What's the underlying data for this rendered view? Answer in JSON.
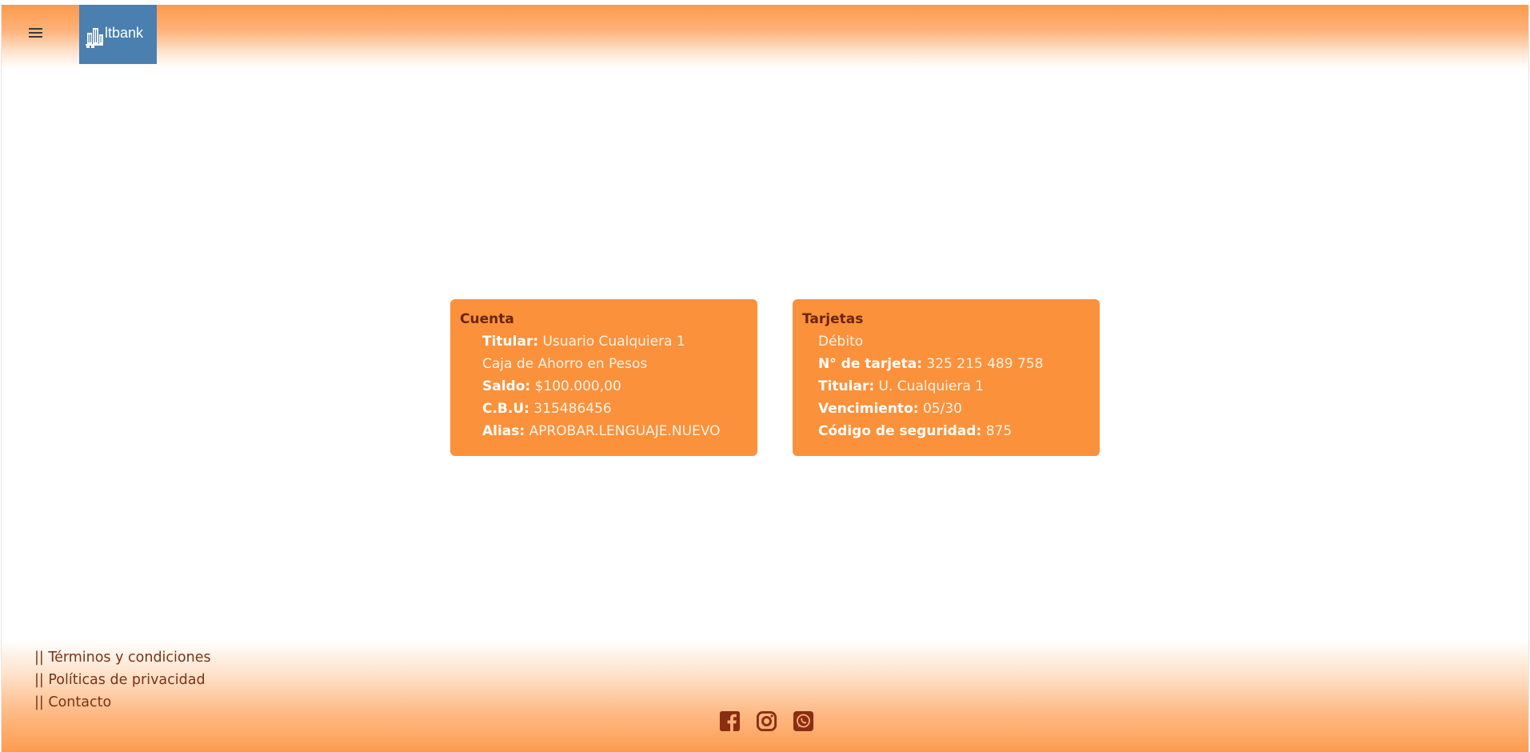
{
  "brand": {
    "logo_text": "ltbank",
    "logo_color": "#4a7fb0"
  },
  "header": {
    "menu_icon": "hamburger-menu-icon",
    "accent_color": "#fd9a4c"
  },
  "cuenta": {
    "title": "Cuenta",
    "titular_label": "Titular:",
    "titular_value": "Usuario Cualquiera 1",
    "account_type": "Caja de Ahorro en Pesos",
    "saldo_label": "Saldo:",
    "saldo_value": "$100.000,00",
    "cbu_label": "C.B.U:",
    "cbu_value": "315486456",
    "alias_label": "Alias:",
    "alias_value": "APROBAR.LENGUAJE.NUEVO"
  },
  "tarjetas": {
    "title": "Tarjetas",
    "card_type": "Débito",
    "numero_label": "N° de tarjeta:",
    "numero_value": "325 215 489 758",
    "titular_label": "Titular:",
    "titular_value": "U. Cualquiera 1",
    "vencimiento_label": "Vencimiento:",
    "vencimiento_value": "05/30",
    "codigo_label": "Código de seguridad:",
    "codigo_value": "875"
  },
  "footer": {
    "links": [
      {
        "label": "|| Términos y condiciones"
      },
      {
        "label": "|| Políticas de privacidad"
      },
      {
        "label": "|| Contacto"
      }
    ],
    "social_icons": [
      "facebook-icon",
      "instagram-icon",
      "whatsapp-icon"
    ],
    "icon_color": "#8a2e12"
  },
  "colors": {
    "card_bg": "#fb913b",
    "card_title": "#6b2410",
    "footer_link": "#7a3316"
  }
}
